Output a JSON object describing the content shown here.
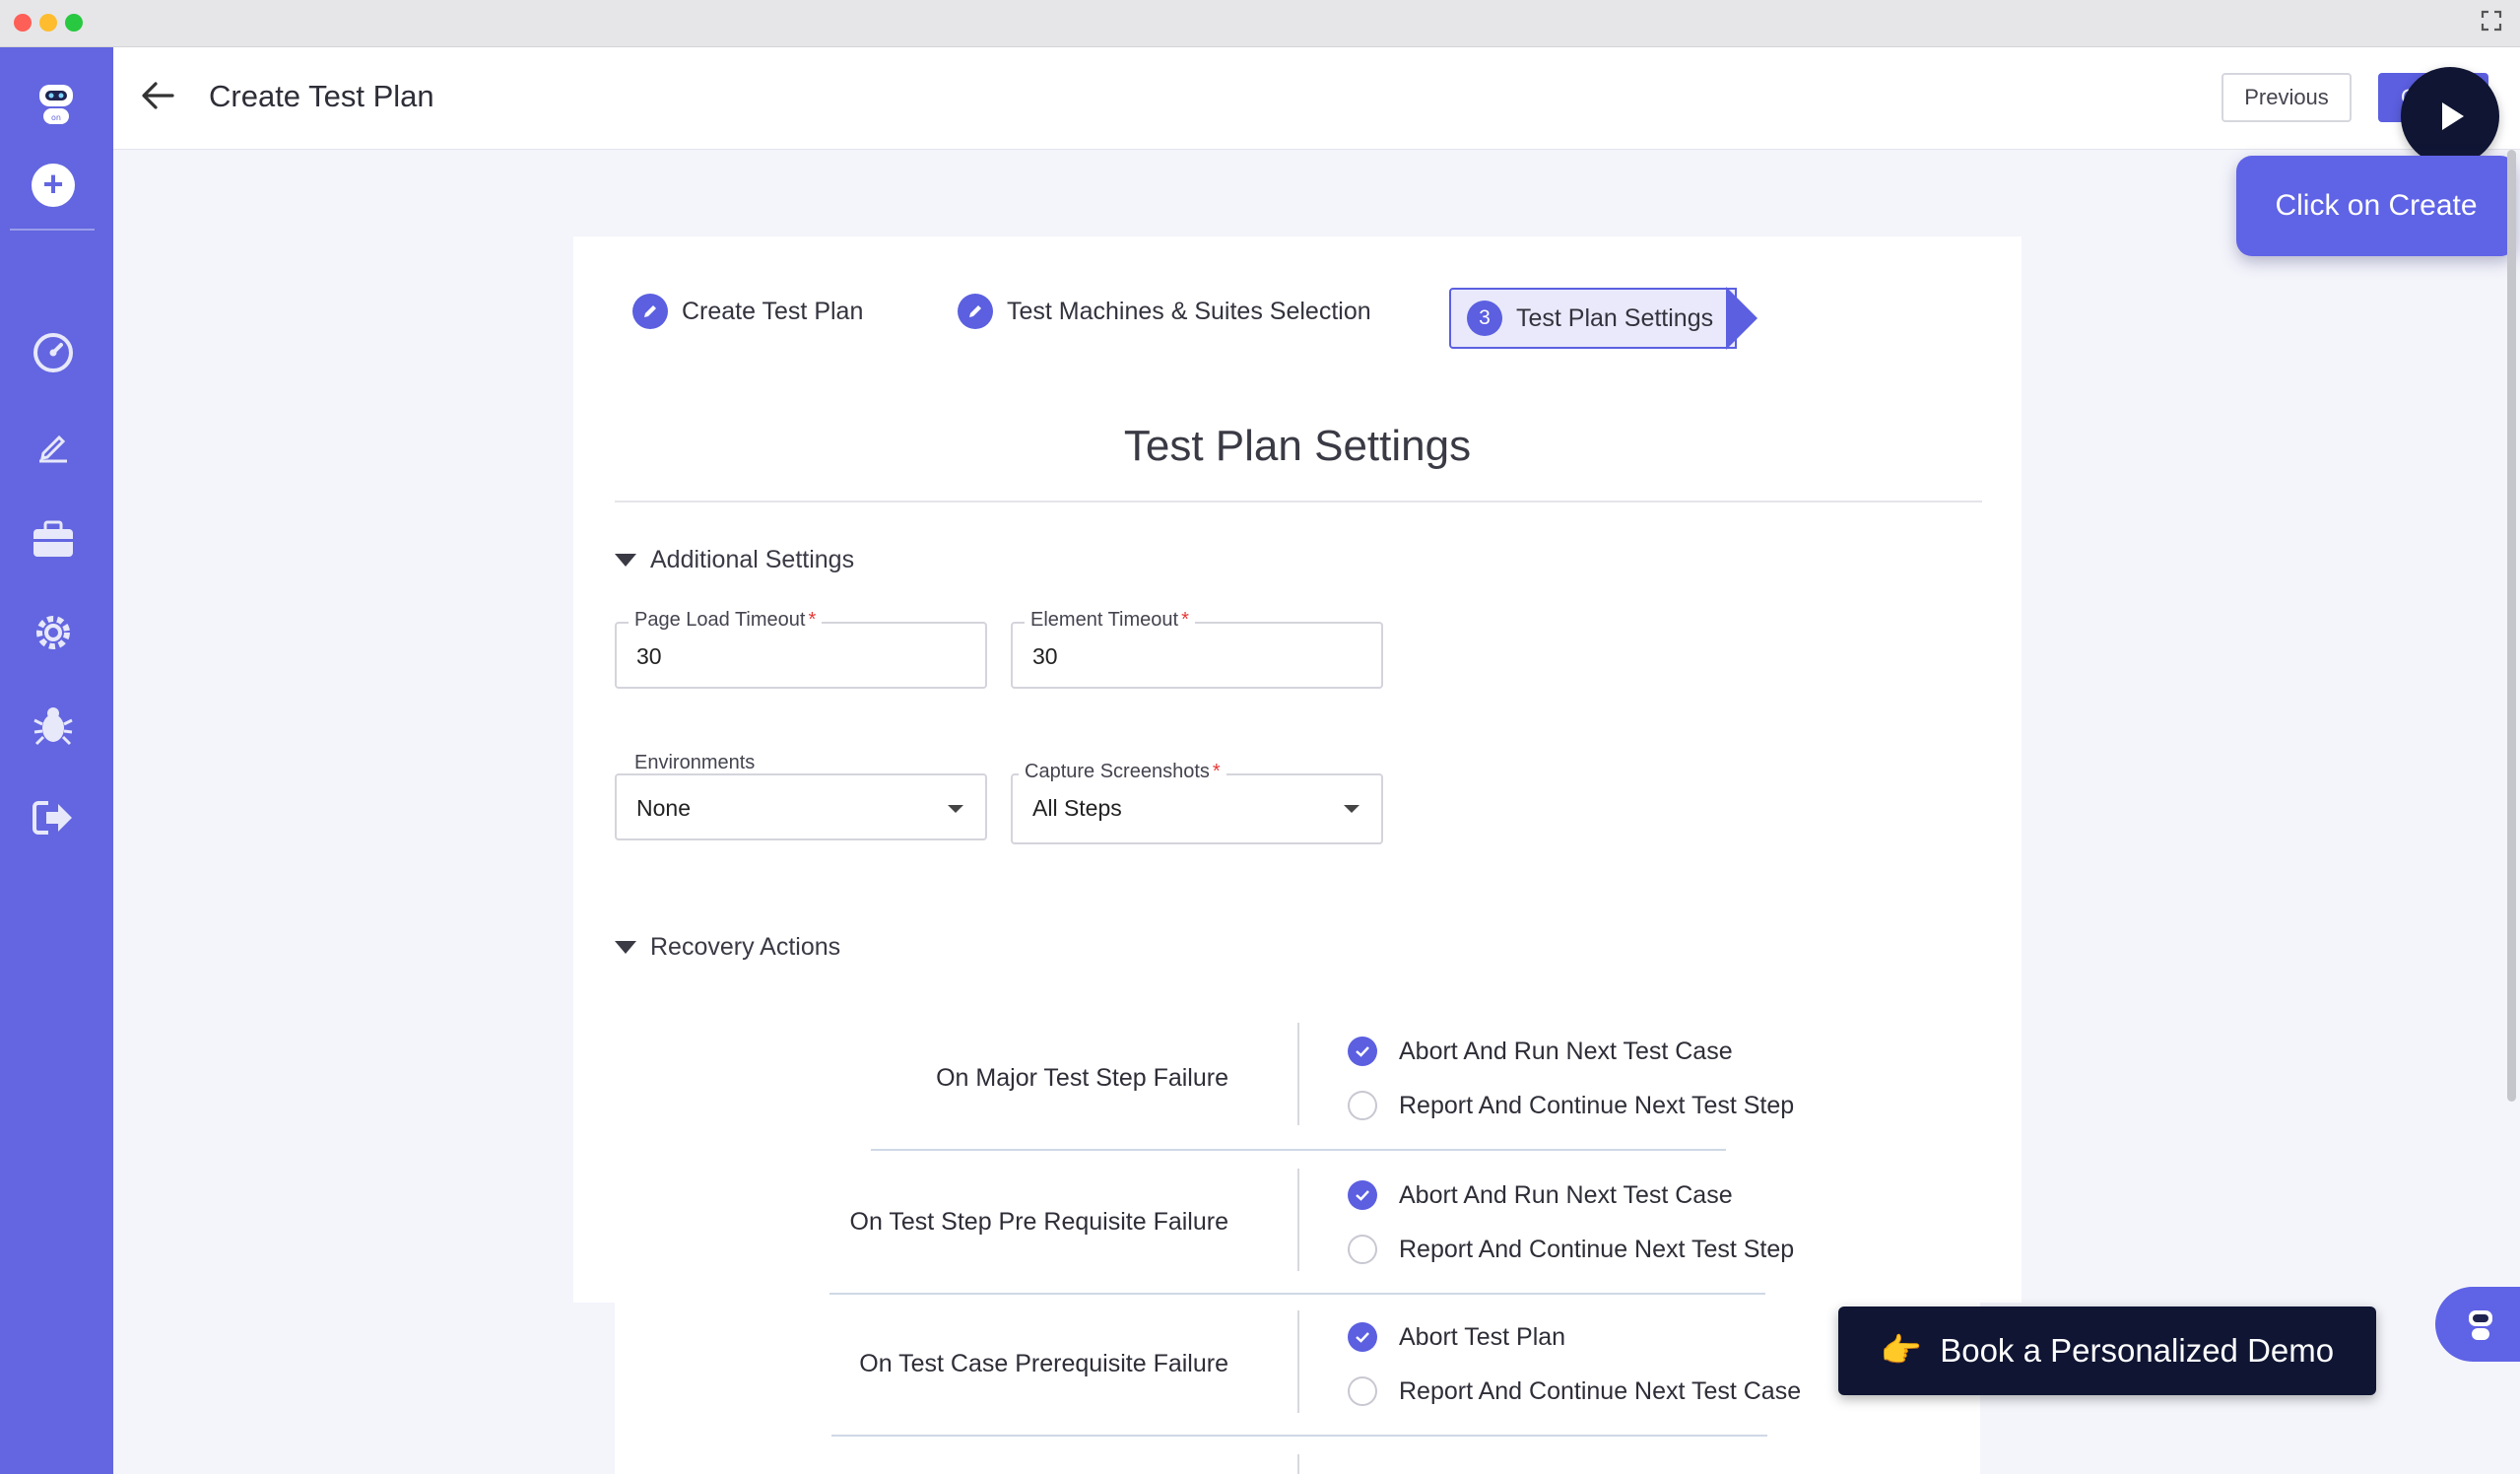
{
  "header": {
    "title": "Create Test Plan",
    "previous_label": "Previous",
    "create_label": "Create"
  },
  "stepper": {
    "steps": [
      {
        "label": "Create Test Plan",
        "status": "done"
      },
      {
        "label": "Test Machines & Suites Selection",
        "status": "done"
      },
      {
        "label": "Test Plan Settings",
        "number": "3",
        "status": "active"
      }
    ]
  },
  "section_title": "Test Plan Settings",
  "additional_settings": {
    "title": "Additional Settings",
    "page_load_timeout": {
      "label": "Page Load Timeout",
      "value": "30"
    },
    "element_timeout": {
      "label": "Element Timeout",
      "value": "30"
    },
    "environments": {
      "label": "Environments",
      "value": "None"
    },
    "capture_screenshots": {
      "label": "Capture Screenshots",
      "value": "All Steps"
    },
    "required_mark": "*"
  },
  "recovery_actions": {
    "title": "Recovery Actions",
    "groups": [
      {
        "label": "On Major Test Step Failure",
        "options": [
          {
            "label": "Abort And Run Next Test Case",
            "checked": true
          },
          {
            "label": "Report And Continue Next Test Step",
            "checked": false
          }
        ]
      },
      {
        "label": "On Test Step Pre Requisite Failure",
        "options": [
          {
            "label": "Abort And Run Next Test Case",
            "checked": true
          },
          {
            "label": "Report And Continue Next Test Step",
            "checked": false
          }
        ]
      },
      {
        "label": "On Test Case Prerequisite Failure",
        "options": [
          {
            "label": "Abort Test Plan",
            "checked": true
          },
          {
            "label": "Report And Continue Next Test Case",
            "checked": false
          }
        ]
      }
    ]
  },
  "guide": {
    "tooltip": "Click on Create",
    "demo_button": "Book a Personalized Demo",
    "demo_icon": "👉"
  },
  "colors": {
    "accent": "#5b5fe0",
    "sidebar": "#6366e0",
    "dark": "#0f1533"
  },
  "icons": {
    "sidebar": [
      "robot-logo-icon",
      "add-icon",
      "dashboard-icon",
      "edit-icon",
      "briefcase-icon",
      "settings-icon",
      "bug-icon",
      "logout-icon"
    ]
  }
}
